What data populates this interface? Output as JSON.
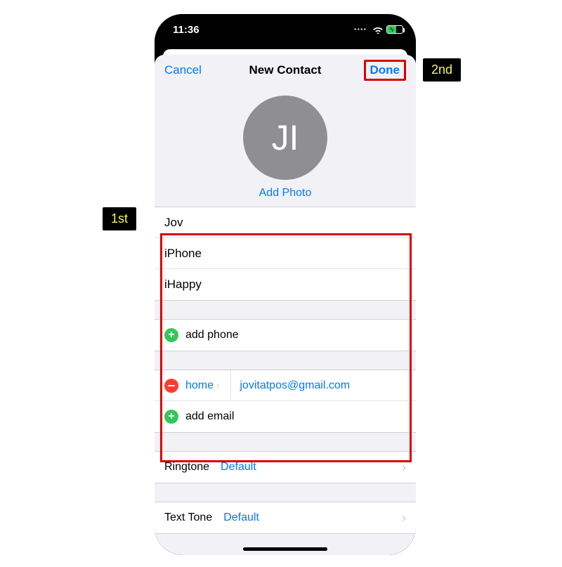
{
  "statusbar": {
    "time": "11:36"
  },
  "nav": {
    "cancel": "Cancel",
    "title": "New Contact",
    "done": "Done"
  },
  "avatar": {
    "initials": "JI",
    "add_photo": "Add Photo"
  },
  "name_fields": {
    "first": "Jov",
    "last": "iPhone",
    "company": "iHappy"
  },
  "phone": {
    "add_label": "add phone"
  },
  "email": {
    "entries": [
      {
        "type_label": "home",
        "value": "jovitatpos@gmail.com"
      }
    ],
    "add_label": "add email"
  },
  "ringtone": {
    "label": "Ringtone",
    "value": "Default"
  },
  "text_tone": {
    "label": "Text Tone",
    "value": "Default"
  },
  "callouts": {
    "first": "1st",
    "second": "2nd"
  }
}
